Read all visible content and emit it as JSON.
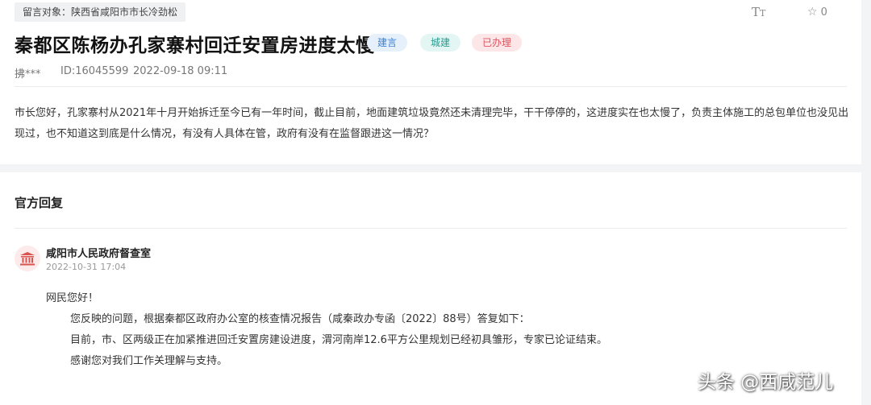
{
  "header": {
    "target_label": "留言对象：陕西省咸阳市市长冷劲松",
    "font_toggle_large": "T",
    "font_toggle_small": "T",
    "star_count": "0"
  },
  "message": {
    "title": "秦都区陈杨办孔家寨村回迁安置房进度太慢",
    "badges": [
      "建言",
      "城建",
      "已办理"
    ],
    "user": "拂***",
    "id": "ID:16045599",
    "time": "2022-09-18 09:11",
    "body": "市长您好，孔家寨村从2021年十月开始拆迁至今已有一年时间，截止目前，地面建筑垃圾竟然还未清理完毕，干干停停的，这进度实在也太慢了，负责主体施工的总包单位也没见出现过，也不知道这到底是什么情况，有没有人具体在管，政府有没有在监督跟进这一情况？"
  },
  "reply": {
    "heading": "官方回复",
    "office": "咸阳市人民政府督查室",
    "time": "2022-10-31 17:04",
    "lines": [
      "网民您好！",
      "您反映的问题，根据秦都区政府办公室的核查情况报告（咸秦政办专函〔2022〕88号）答复如下：",
      "目前，市、区两级正在加紧推进回迁安置房建设进度，渭河南岸12.6平方公里规划已经初具雏形，专家已论证结束。",
      "感谢您对我们工作关理解与支持。"
    ]
  },
  "watermark": "头条 @西咸范儿",
  "colors": {
    "badge_jianyan": "#3b7fd0",
    "badge_chengjian": "#2b9b8e",
    "badge_done": "#e0545e",
    "gov_icon": "#d9534f"
  },
  "icons": [
    "font-size-icon",
    "star-icon",
    "government-building-icon"
  ]
}
